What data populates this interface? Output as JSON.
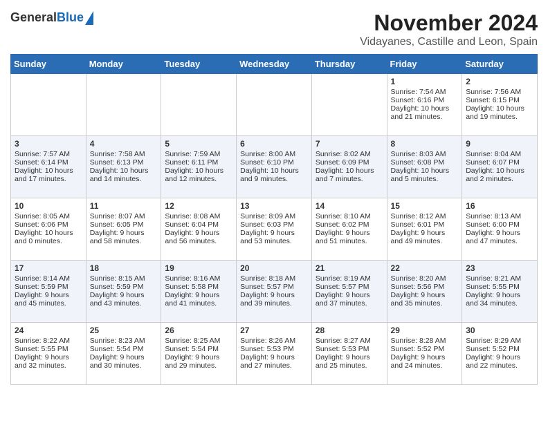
{
  "header": {
    "logo_general": "General",
    "logo_blue": "Blue",
    "title": "November 2024",
    "subtitle": "Vidayanes, Castille and Leon, Spain"
  },
  "days_of_week": [
    "Sunday",
    "Monday",
    "Tuesday",
    "Wednesday",
    "Thursday",
    "Friday",
    "Saturday"
  ],
  "weeks": [
    [
      {
        "day": "",
        "sunrise": "",
        "sunset": "",
        "daylight": ""
      },
      {
        "day": "",
        "sunrise": "",
        "sunset": "",
        "daylight": ""
      },
      {
        "day": "",
        "sunrise": "",
        "sunset": "",
        "daylight": ""
      },
      {
        "day": "",
        "sunrise": "",
        "sunset": "",
        "daylight": ""
      },
      {
        "day": "",
        "sunrise": "",
        "sunset": "",
        "daylight": ""
      },
      {
        "day": "1",
        "sunrise": "Sunrise: 7:54 AM",
        "sunset": "Sunset: 6:16 PM",
        "daylight": "Daylight: 10 hours and 21 minutes."
      },
      {
        "day": "2",
        "sunrise": "Sunrise: 7:56 AM",
        "sunset": "Sunset: 6:15 PM",
        "daylight": "Daylight: 10 hours and 19 minutes."
      }
    ],
    [
      {
        "day": "3",
        "sunrise": "Sunrise: 7:57 AM",
        "sunset": "Sunset: 6:14 PM",
        "daylight": "Daylight: 10 hours and 17 minutes."
      },
      {
        "day": "4",
        "sunrise": "Sunrise: 7:58 AM",
        "sunset": "Sunset: 6:13 PM",
        "daylight": "Daylight: 10 hours and 14 minutes."
      },
      {
        "day": "5",
        "sunrise": "Sunrise: 7:59 AM",
        "sunset": "Sunset: 6:11 PM",
        "daylight": "Daylight: 10 hours and 12 minutes."
      },
      {
        "day": "6",
        "sunrise": "Sunrise: 8:00 AM",
        "sunset": "Sunset: 6:10 PM",
        "daylight": "Daylight: 10 hours and 9 minutes."
      },
      {
        "day": "7",
        "sunrise": "Sunrise: 8:02 AM",
        "sunset": "Sunset: 6:09 PM",
        "daylight": "Daylight: 10 hours and 7 minutes."
      },
      {
        "day": "8",
        "sunrise": "Sunrise: 8:03 AM",
        "sunset": "Sunset: 6:08 PM",
        "daylight": "Daylight: 10 hours and 5 minutes."
      },
      {
        "day": "9",
        "sunrise": "Sunrise: 8:04 AM",
        "sunset": "Sunset: 6:07 PM",
        "daylight": "Daylight: 10 hours and 2 minutes."
      }
    ],
    [
      {
        "day": "10",
        "sunrise": "Sunrise: 8:05 AM",
        "sunset": "Sunset: 6:06 PM",
        "daylight": "Daylight: 10 hours and 0 minutes."
      },
      {
        "day": "11",
        "sunrise": "Sunrise: 8:07 AM",
        "sunset": "Sunset: 6:05 PM",
        "daylight": "Daylight: 9 hours and 58 minutes."
      },
      {
        "day": "12",
        "sunrise": "Sunrise: 8:08 AM",
        "sunset": "Sunset: 6:04 PM",
        "daylight": "Daylight: 9 hours and 56 minutes."
      },
      {
        "day": "13",
        "sunrise": "Sunrise: 8:09 AM",
        "sunset": "Sunset: 6:03 PM",
        "daylight": "Daylight: 9 hours and 53 minutes."
      },
      {
        "day": "14",
        "sunrise": "Sunrise: 8:10 AM",
        "sunset": "Sunset: 6:02 PM",
        "daylight": "Daylight: 9 hours and 51 minutes."
      },
      {
        "day": "15",
        "sunrise": "Sunrise: 8:12 AM",
        "sunset": "Sunset: 6:01 PM",
        "daylight": "Daylight: 9 hours and 49 minutes."
      },
      {
        "day": "16",
        "sunrise": "Sunrise: 8:13 AM",
        "sunset": "Sunset: 6:00 PM",
        "daylight": "Daylight: 9 hours and 47 minutes."
      }
    ],
    [
      {
        "day": "17",
        "sunrise": "Sunrise: 8:14 AM",
        "sunset": "Sunset: 5:59 PM",
        "daylight": "Daylight: 9 hours and 45 minutes."
      },
      {
        "day": "18",
        "sunrise": "Sunrise: 8:15 AM",
        "sunset": "Sunset: 5:59 PM",
        "daylight": "Daylight: 9 hours and 43 minutes."
      },
      {
        "day": "19",
        "sunrise": "Sunrise: 8:16 AM",
        "sunset": "Sunset: 5:58 PM",
        "daylight": "Daylight: 9 hours and 41 minutes."
      },
      {
        "day": "20",
        "sunrise": "Sunrise: 8:18 AM",
        "sunset": "Sunset: 5:57 PM",
        "daylight": "Daylight: 9 hours and 39 minutes."
      },
      {
        "day": "21",
        "sunrise": "Sunrise: 8:19 AM",
        "sunset": "Sunset: 5:57 PM",
        "daylight": "Daylight: 9 hours and 37 minutes."
      },
      {
        "day": "22",
        "sunrise": "Sunrise: 8:20 AM",
        "sunset": "Sunset: 5:56 PM",
        "daylight": "Daylight: 9 hours and 35 minutes."
      },
      {
        "day": "23",
        "sunrise": "Sunrise: 8:21 AM",
        "sunset": "Sunset: 5:55 PM",
        "daylight": "Daylight: 9 hours and 34 minutes."
      }
    ],
    [
      {
        "day": "24",
        "sunrise": "Sunrise: 8:22 AM",
        "sunset": "Sunset: 5:55 PM",
        "daylight": "Daylight: 9 hours and 32 minutes."
      },
      {
        "day": "25",
        "sunrise": "Sunrise: 8:23 AM",
        "sunset": "Sunset: 5:54 PM",
        "daylight": "Daylight: 9 hours and 30 minutes."
      },
      {
        "day": "26",
        "sunrise": "Sunrise: 8:25 AM",
        "sunset": "Sunset: 5:54 PM",
        "daylight": "Daylight: 9 hours and 29 minutes."
      },
      {
        "day": "27",
        "sunrise": "Sunrise: 8:26 AM",
        "sunset": "Sunset: 5:53 PM",
        "daylight": "Daylight: 9 hours and 27 minutes."
      },
      {
        "day": "28",
        "sunrise": "Sunrise: 8:27 AM",
        "sunset": "Sunset: 5:53 PM",
        "daylight": "Daylight: 9 hours and 25 minutes."
      },
      {
        "day": "29",
        "sunrise": "Sunrise: 8:28 AM",
        "sunset": "Sunset: 5:52 PM",
        "daylight": "Daylight: 9 hours and 24 minutes."
      },
      {
        "day": "30",
        "sunrise": "Sunrise: 8:29 AM",
        "sunset": "Sunset: 5:52 PM",
        "daylight": "Daylight: 9 hours and 22 minutes."
      }
    ]
  ]
}
